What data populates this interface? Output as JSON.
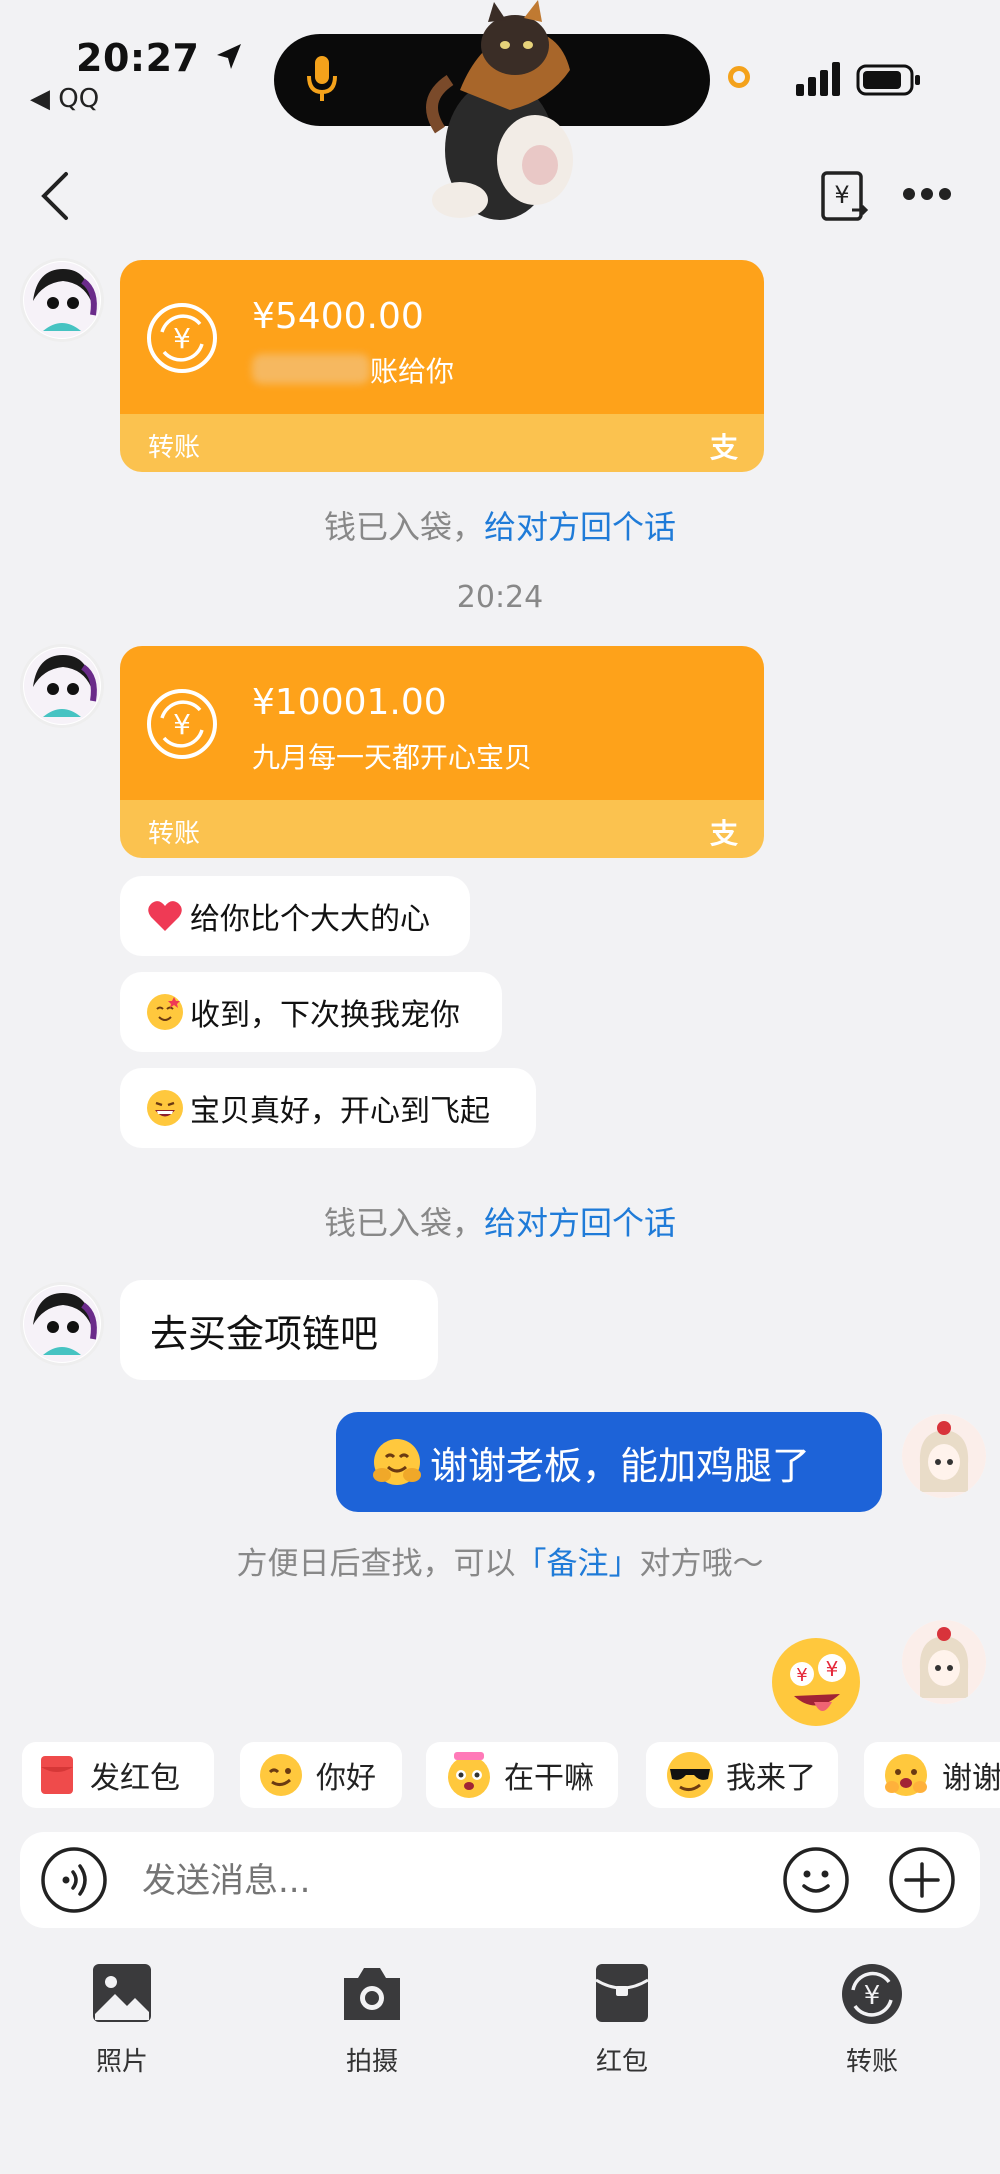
{
  "status_bar": {
    "time": "20:27",
    "back_app": "◀ QQ"
  },
  "transfers": [
    {
      "amount": "¥5400.00",
      "note": "账给你",
      "label": "转账"
    },
    {
      "amount": "¥10001.00",
      "note": "九月每一天都开心宝贝",
      "label": "转账"
    }
  ],
  "notice_received": {
    "text": "钱已入袋，",
    "link": "给对方回个话"
  },
  "timestamp": "20:24",
  "messages": [
    {
      "text": "给你比个大大的心"
    },
    {
      "text": "收到，下次换我宠你"
    },
    {
      "text": "宝贝真好，开心到飞起"
    },
    {
      "text": "去买金项链吧"
    },
    {
      "text": "谢谢老板，能加鸡腿了"
    }
  ],
  "remark_tip": {
    "before": "方便日后查找，可以",
    "link": "「备注」",
    "after": "对方哦～"
  },
  "quick_replies": [
    "发红包",
    "你好",
    "在干嘛",
    "我来了",
    "谢谢"
  ],
  "input": {
    "placeholder": "发送消息..."
  },
  "toolbar": [
    "照片",
    "拍摄",
    "红包",
    "转账"
  ],
  "colors": {
    "transfer_orange": "#fea21a",
    "transfer_footer": "#fbc24f",
    "blue_bubble": "#1d63d8",
    "link": "#1f7bd8",
    "background": "#f2f2f4"
  }
}
